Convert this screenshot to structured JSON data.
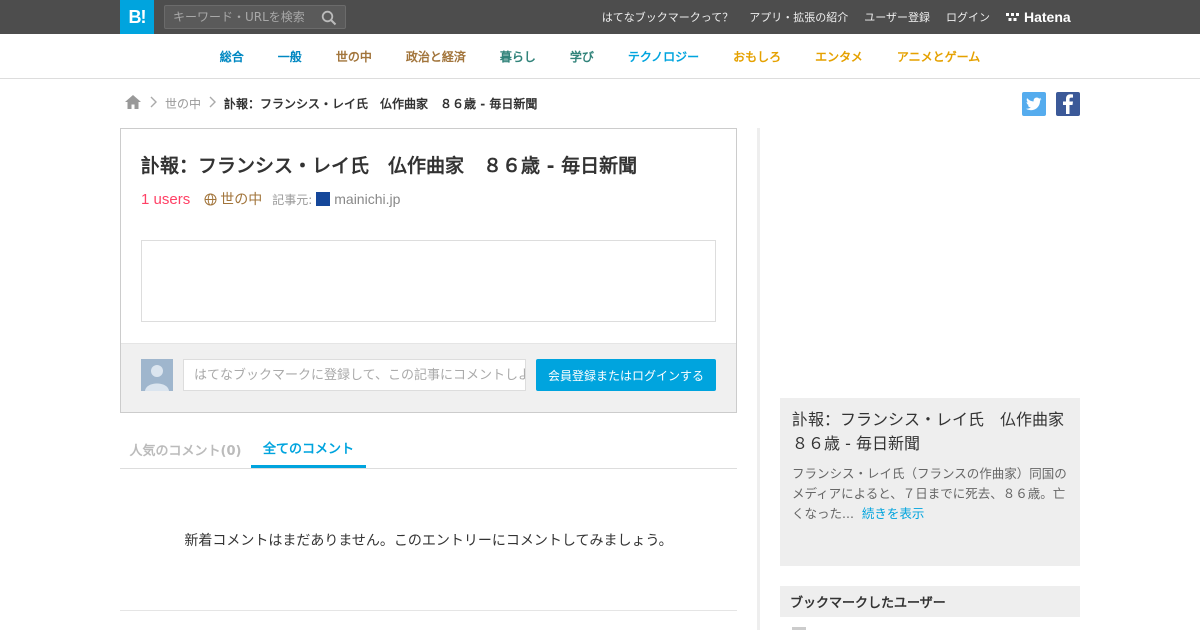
{
  "topbar": {
    "logo": "B!",
    "search_placeholder": "キーワード・URLを検索",
    "links": [
      "はてなブックマークって？",
      "アプリ・拡張の紹介",
      "ユーザー登録",
      "ログイン"
    ],
    "hatena": "Hatena"
  },
  "nav": [
    {
      "label": "総合",
      "color": "#0088c2"
    },
    {
      "label": "一般",
      "color": "#0088c2"
    },
    {
      "label": "世の中",
      "color": "#a2753c"
    },
    {
      "label": "政治と経済",
      "color": "#a2753c"
    },
    {
      "label": "暮らし",
      "color": "#31837a"
    },
    {
      "label": "学び",
      "color": "#31837a"
    },
    {
      "label": "テクノロジー",
      "color": "#00a4de"
    },
    {
      "label": "おもしろ",
      "color": "#e5a100"
    },
    {
      "label": "エンタメ",
      "color": "#e5a100"
    },
    {
      "label": "アニメとゲーム",
      "color": "#e5a100"
    }
  ],
  "breadcrumb": {
    "category": "世の中",
    "current": "訃報：フランシス・レイ氏　仏作曲家　８６歳 - 毎日新聞"
  },
  "entry": {
    "title": "訃報：フランシス・レイ氏　仏作曲家　８６歳 - 毎日新聞",
    "users": "1 users",
    "category": "世の中",
    "source_label": "記事元:",
    "source_domain": "mainichi.jp",
    "comment_placeholder": "はてなブックマークに登録して、この記事にコメントしよう",
    "login_button": "会員登録またはログインする"
  },
  "tabs": {
    "popular": "人気のコメント(0)",
    "all": "全てのコメント"
  },
  "empty_message": "新着コメントはまだありません。このエントリーにコメントしてみましょう。",
  "summary": {
    "title": "訃報：フランシス・レイ氏　仏作曲家　８６歳 - 毎日新聞",
    "text": "フランシス・レイ氏（フランスの作曲家）同国のメディアによると、７日までに死去、８６歳。亡くなった...",
    "more": "続きを表示"
  },
  "bookmark_users_heading": "ブックマークしたユーザー",
  "colors": {
    "accent": "#00a4de",
    "users": "#ff4166",
    "topbar": "#4d4d4d"
  }
}
